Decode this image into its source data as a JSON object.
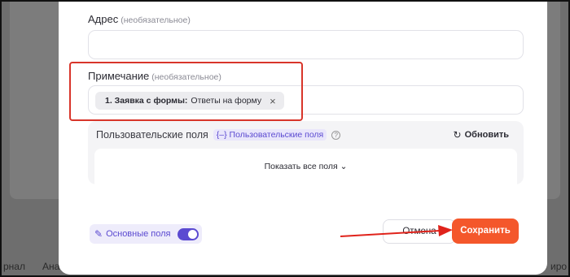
{
  "background": {
    "tabs": [
      "рнал",
      "Ана",
      "иро"
    ]
  },
  "form": {
    "address": {
      "label": "Адрес",
      "optional": "(необязательное)",
      "value": ""
    },
    "note": {
      "label": "Примечание",
      "optional": "(необязательное)",
      "chip": {
        "prefix": "1. Заявка с формы:",
        "text": "Ответы на форму",
        "remove": "×"
      }
    },
    "custom_fields": {
      "title": "Пользовательские поля",
      "tag": "{–} Пользовательские поля",
      "info": "?",
      "refresh_icon": "refresh-icon",
      "refresh_label": "Обновить",
      "show_all": "Показать все поля ⌄"
    }
  },
  "footer": {
    "main_fields_label": "Основные поля",
    "main_fields_on": true,
    "cancel_label": "Отмена",
    "save_label": "Сохранить"
  },
  "colors": {
    "accent": "#5b4ad1",
    "save": "#f4572b",
    "highlight": "#d8352a"
  }
}
